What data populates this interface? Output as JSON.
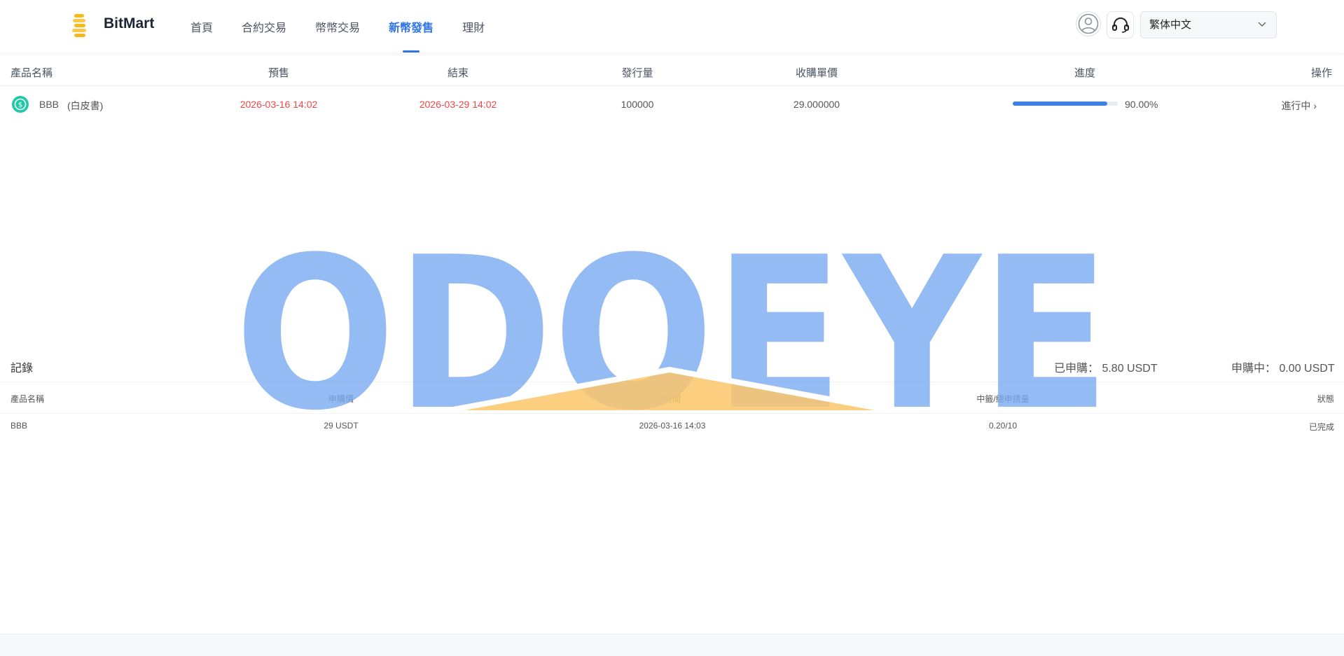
{
  "header": {
    "brand": "BitMart",
    "nav": [
      "首頁",
      "合約交易",
      "幣幣交易",
      "新幣發售",
      "理財"
    ],
    "active_nav": "新幣發售",
    "language": "繁体中文",
    "icons": [
      "logo-icon",
      "user-icon",
      "headset-icon",
      "chevron-down-icon"
    ],
    "accent_color": "#2f74e6"
  },
  "products": {
    "columns": [
      "產品名稱",
      "預售",
      "結束",
      "發行量",
      "收購單價",
      "進度",
      "操作"
    ],
    "rows": [
      {
        "name": "BBB",
        "whitepaper": "(白皮書)",
        "presale": "2026-03-16 14:02",
        "end": "2026-03-29 14:02",
        "supply": "100000",
        "price": "29.000000",
        "progress": 0.9,
        "progress_text": "90.00%",
        "action": "進行中 ›"
      }
    ]
  },
  "records": {
    "title": "記錄",
    "subscribed": "已申購： 5.80 USDT",
    "subscribing": "申購中： 0.00 USDT",
    "columns": [
      "產品名稱",
      "申購價",
      "時間",
      "中籤/總申請量",
      "狀態"
    ],
    "rows": [
      {
        "name": "BBB",
        "price": "29 USDT",
        "time": "2026-03-16 14:03",
        "ratio": "0.20/10",
        "status": "已完成"
      }
    ]
  },
  "watermark": {
    "text": "ODOEYE",
    "color": "#7aaaf1",
    "triangle_color": "#fcc56a"
  }
}
